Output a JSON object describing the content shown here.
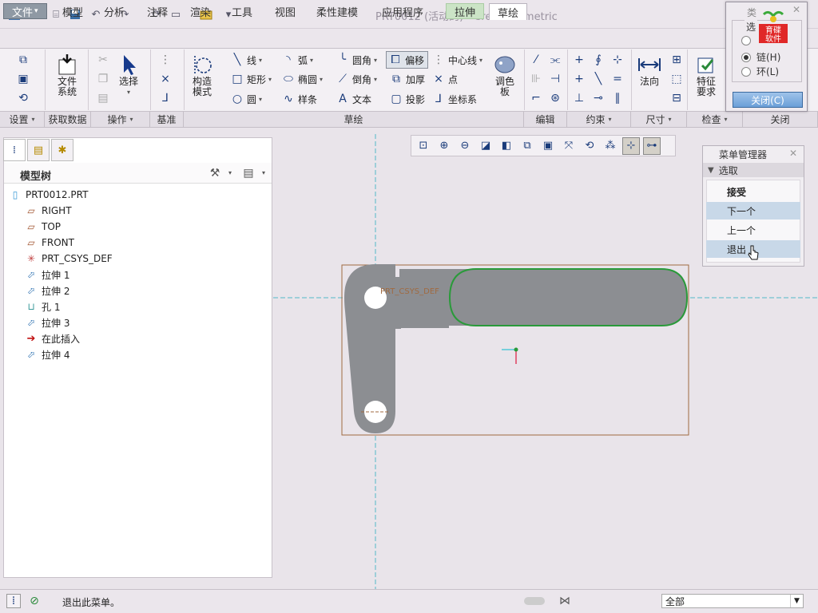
{
  "window_title": "PRT0012 (活动的) - Creo Parametric",
  "tabs": [
    {
      "label": "文件",
      "dropdown": "▾"
    },
    {
      "label": "模型"
    },
    {
      "label": "分析"
    },
    {
      "label": "注释"
    },
    {
      "label": "渲染"
    },
    {
      "label": "工具"
    },
    {
      "label": "视图"
    },
    {
      "label": "柔性建模"
    },
    {
      "label": "应用程序"
    },
    {
      "label": "拉伸"
    },
    {
      "label": "草绘"
    }
  ],
  "ribbon": {
    "file_system": "文件\n系统",
    "select": "选择",
    "construct_mode": "构造\n模式",
    "line": "线",
    "arc": "弧",
    "fillet": "圆角",
    "offset": "偏移",
    "centerline": "中心线",
    "rectangle": "矩形",
    "ellipse": "椭圆",
    "chamfer": "倒角",
    "thicken": "加厚",
    "point": "点",
    "circle": "圆",
    "spline": "样条",
    "text": "文本",
    "project": "投影",
    "coordsys": "坐标系",
    "palette": "调色\n板",
    "normal": "法向",
    "feature_req": "特征\n要求"
  },
  "groups": [
    "设置",
    "获取数据",
    "操作",
    "基准",
    "草绘",
    "编辑",
    "约束",
    "尺寸",
    "检查",
    "关闭"
  ],
  "model_tree": {
    "title": "模型树",
    "items": [
      "PRT0012.PRT",
      "RIGHT",
      "TOP",
      "FRONT",
      "PRT_CSYS_DEF",
      "拉伸 1",
      "拉伸 2",
      "孔 1",
      "拉伸 3",
      "在此插入",
      "拉伸 4"
    ]
  },
  "canvas": {
    "csys_label": "PRT_CSYS_DEF"
  },
  "menu_manager": {
    "title": "菜单管理器",
    "section": "选取",
    "items": [
      "接受",
      "下一个",
      "上一个",
      "退出"
    ]
  },
  "dialog": {
    "title": "类",
    "subtitle": "选",
    "options": [
      "",
      "链(H)",
      "环(L)"
    ],
    "close_button": "关闭(C)"
  },
  "watermark": "育碟软件",
  "status": {
    "message": "退出此菜单。",
    "filter_value": "全部"
  },
  "colors": {
    "accent_green": "#2a9a3a",
    "highlight_blue": "#c8d8e8",
    "sketch_fill": "#8c8e92",
    "ref_line": "#52b7c8"
  }
}
